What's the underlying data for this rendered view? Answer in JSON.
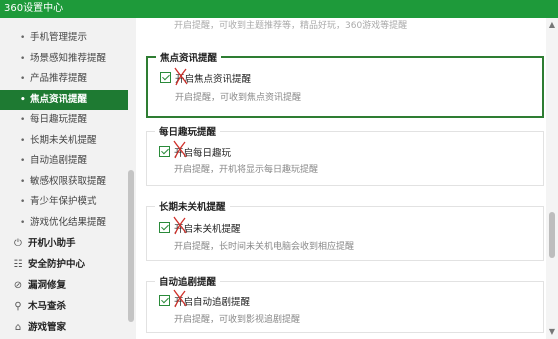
{
  "window": {
    "title": "360设置中心"
  },
  "sidebar": {
    "sub_items": [
      {
        "label": "手机管理提示"
      },
      {
        "label": "场景感知推荐提醒"
      },
      {
        "label": "产品推荐提醒"
      },
      {
        "label": "焦点资讯提醒",
        "active": true
      },
      {
        "label": "每日趣玩提醒"
      },
      {
        "label": "长期未关机提醒"
      },
      {
        "label": "自动追剧提醒"
      },
      {
        "label": "敏感权限获取提醒"
      },
      {
        "label": "青少年保护模式"
      },
      {
        "label": "游戏优化结果提醒"
      }
    ],
    "groups": [
      {
        "label": "开机小助手",
        "icon": "power-icon"
      },
      {
        "label": "安全防护中心",
        "icon": "shield-icon"
      },
      {
        "label": "漏洞修复",
        "icon": "patch-icon"
      },
      {
        "label": "木马查杀",
        "icon": "trojan-icon"
      },
      {
        "label": "游戏管家",
        "icon": "game-icon"
      }
    ]
  },
  "content": {
    "top_partial_desc": "开启提醒，可收到主题推荐等，精品好玩，360游戏等提醒",
    "cards": [
      {
        "title": "焦点资讯提醒",
        "checkbox_label": "开启焦点资讯提醒",
        "checked": true,
        "desc": "开启提醒，可收到焦点资讯提醒"
      },
      {
        "title": "每日趣玩提醒",
        "checkbox_label": "开启每日趣玩",
        "checked": true,
        "desc": "开启提醒，开机将显示每日趣玩提醒"
      },
      {
        "title": "长期未关机提醒",
        "checkbox_label": "开启未关机提醒",
        "checked": true,
        "desc": "开启提醒，长时间未关机电脑会收到相应提醒"
      },
      {
        "title": "自动追剧提醒",
        "checkbox_label": "开启自动追剧提醒",
        "checked": true,
        "desc": "开启提醒，可收到影视追剧提醒"
      }
    ]
  },
  "colors": {
    "titlebar": "#1e9a3a",
    "active": "#1e7a32",
    "accent": "#2a8a3a",
    "annotation": "#d0302a"
  }
}
